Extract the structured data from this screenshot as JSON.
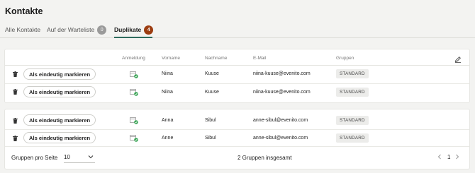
{
  "page": {
    "title": "Kontakte"
  },
  "tabs": [
    {
      "label": "Alle Kontakte",
      "badge": ""
    },
    {
      "label": "Auf der Warteliste",
      "badge": "0"
    },
    {
      "label": "Duplikate",
      "badge": "4"
    }
  ],
  "table": {
    "headers": {
      "registration": "Anmeldung",
      "firstname": "Vorname",
      "lastname": "Nachname",
      "email": "E-Mail",
      "groups": "Gruppen"
    },
    "mark_label": "Als eindeutig markieren",
    "groups": [
      [
        {
          "firstname": "Niina",
          "lastname": "Kuuse",
          "email": "niina-kuuse@evenito.com",
          "group": "STANDARD"
        },
        {
          "firstname": "Niina",
          "lastname": "Kuuse",
          "email": "niina-kuuse@evenito.com",
          "group": "STANDARD"
        }
      ],
      [
        {
          "firstname": "Anna",
          "lastname": "Sibul",
          "email": "anne-sibul@evenito.com",
          "group": "STANDARD"
        },
        {
          "firstname": "Anne",
          "lastname": "Sibul",
          "email": "anne-sibul@evenito.com",
          "group": "STANDARD"
        }
      ]
    ]
  },
  "footer": {
    "per_page_label": "Gruppen pro Seite",
    "per_page_value": "10",
    "total_label": "2 Gruppen insgesamt",
    "page": "1",
    "prev_icon": "chevron-left-icon",
    "next_icon": "chevron-right-icon"
  },
  "colors": {
    "active_tab_underline": "#2e6b5e",
    "duplicate_badge": "#9c3d11",
    "waitlist_badge": "#9a9a9a",
    "check_green": "#3aa556"
  },
  "icons": {
    "edit": "pencil-icon",
    "delete": "trash-icon",
    "registration": "calendar-check-icon",
    "dropdown": "chevron-down-icon"
  }
}
